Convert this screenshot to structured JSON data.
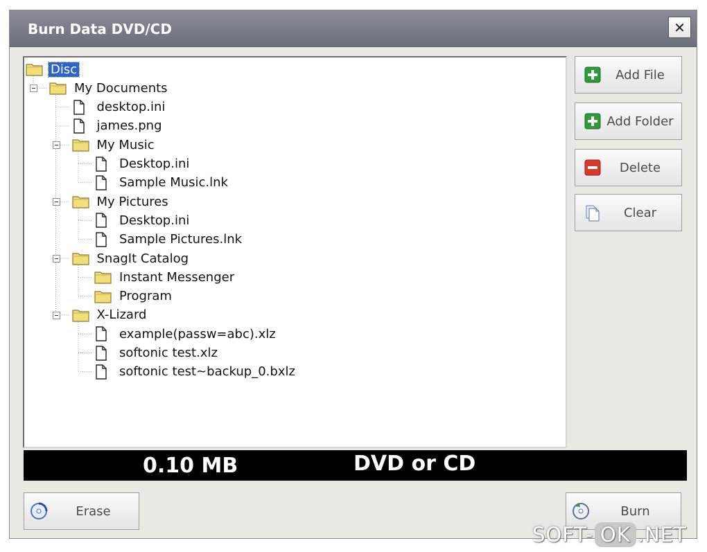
{
  "window": {
    "title": "Burn Data DVD/CD",
    "close_label": "✕"
  },
  "tree": {
    "nodes": [
      {
        "label": "Disc",
        "type": "disc-folder",
        "depth": 0,
        "selected": true
      },
      {
        "label": "My Documents",
        "type": "folder",
        "depth": 1,
        "expanded": true
      },
      {
        "label": "desktop.ini",
        "type": "file",
        "depth": 2
      },
      {
        "label": "james.png",
        "type": "file",
        "depth": 2
      },
      {
        "label": "My Music",
        "type": "folder",
        "depth": 2,
        "expanded": true
      },
      {
        "label": "Desktop.ini",
        "type": "file",
        "depth": 3
      },
      {
        "label": "Sample Music.lnk",
        "type": "file",
        "depth": 3
      },
      {
        "label": "My Pictures",
        "type": "folder",
        "depth": 2,
        "expanded": true
      },
      {
        "label": "Desktop.ini",
        "type": "file",
        "depth": 3
      },
      {
        "label": "Sample Pictures.lnk",
        "type": "file",
        "depth": 3
      },
      {
        "label": "SnagIt Catalog",
        "type": "folder",
        "depth": 2,
        "expanded": true
      },
      {
        "label": "Instant Messenger",
        "type": "folder",
        "depth": 3
      },
      {
        "label": "Program",
        "type": "folder",
        "depth": 3
      },
      {
        "label": "X-Lizard",
        "type": "folder",
        "depth": 2,
        "expanded": true
      },
      {
        "label": "example(passw=abc).xlz",
        "type": "file",
        "depth": 3
      },
      {
        "label": "softonic test.xlz",
        "type": "file",
        "depth": 3
      },
      {
        "label": "softonic test~backup_0.bxlz",
        "type": "file",
        "depth": 3
      }
    ]
  },
  "side_buttons": {
    "add_file": "Add File",
    "add_folder": "Add Folder",
    "delete": "Delete",
    "clear": "Clear"
  },
  "status": {
    "size": "0.10 MB",
    "media": "DVD or CD"
  },
  "bottom_buttons": {
    "erase": "Erase",
    "burn": "Burn"
  },
  "watermark": {
    "left": "SOFT-",
    "middle": "OK",
    "right": ".NET"
  },
  "colors": {
    "selection": "#2e63c9",
    "folder": "#f3de7a",
    "add_green": "#2e9a3a",
    "delete_red": "#d43b2a"
  }
}
